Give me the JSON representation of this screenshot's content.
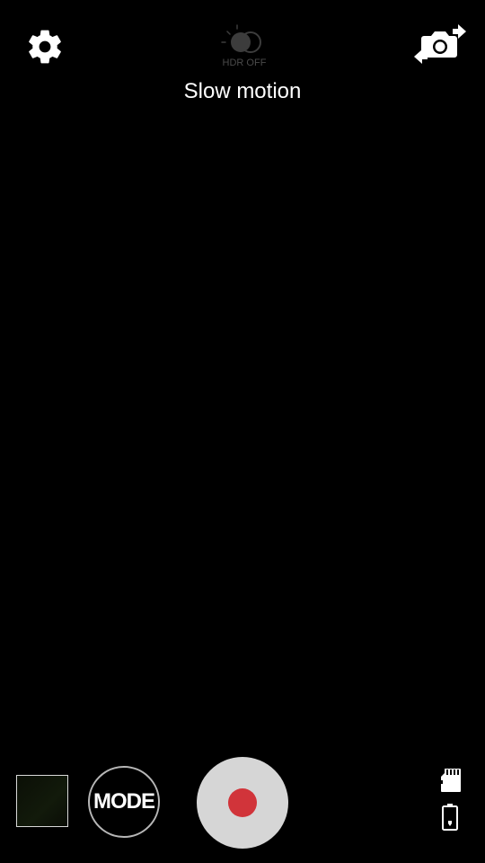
{
  "app": {
    "name": "Camera"
  },
  "top_bar": {
    "settings_icon": "gear-icon",
    "hdr": {
      "icon": "hdr-icon",
      "label": "HDR OFF"
    },
    "switch_camera_icon": "switch-camera-icon",
    "mode_title": "Slow motion"
  },
  "bottom_bar": {
    "thumbnail": "last-capture-thumbnail",
    "mode_button_label": "MODE",
    "record_button": {
      "icon": "record-icon",
      "dot_color": "#d1343a"
    },
    "status_icons": [
      "sd-card-icon",
      "battery-charging-icon"
    ]
  },
  "colors": {
    "background": "#000000",
    "text": "#ffffff",
    "record_ring": "#d6d6d6",
    "record_dot": "#d1343a",
    "hdr_dim": "#4a4a4a"
  }
}
